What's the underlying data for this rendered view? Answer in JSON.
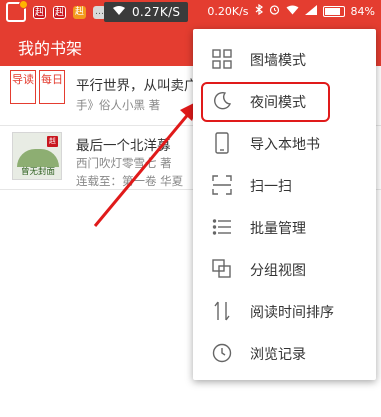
{
  "status_bar": {
    "mini_icons": [
      "赳",
      "赳",
      "赳",
      "…"
    ],
    "net_speed": "0.27K/S",
    "right_speed": "0.20K/s",
    "battery": "84%",
    "battery_level": 0.84
  },
  "header": {
    "title": "我的书架"
  },
  "books": [
    {
      "title": "平行世界，从叫卖广",
      "subtitle": "手》俗人小黑 著",
      "badge": [
        "导读",
        "每日"
      ]
    },
    {
      "title": "最后一个北洋募",
      "subtitle": "西门吹灯零雪七 著",
      "progress": "连载至：第一卷 华夏",
      "cover_text": "曾无封面",
      "cover_stamp": "赳"
    }
  ],
  "menu": {
    "items": [
      {
        "label": "图墙模式",
        "icon": "grid-icon"
      },
      {
        "label": "夜间模式",
        "icon": "moon-icon"
      },
      {
        "label": "导入本地书",
        "icon": "phone-icon"
      },
      {
        "label": "扫一扫",
        "icon": "scan-icon"
      },
      {
        "label": "批量管理",
        "icon": "list-icon"
      },
      {
        "label": "分组视图",
        "icon": "group-icon"
      },
      {
        "label": "阅读时间排序",
        "icon": "sort-icon"
      },
      {
        "label": "浏览记录",
        "icon": "clock-icon"
      }
    ]
  },
  "colors": {
    "accent": "#e43d30",
    "highlight": "#e01a1a"
  }
}
